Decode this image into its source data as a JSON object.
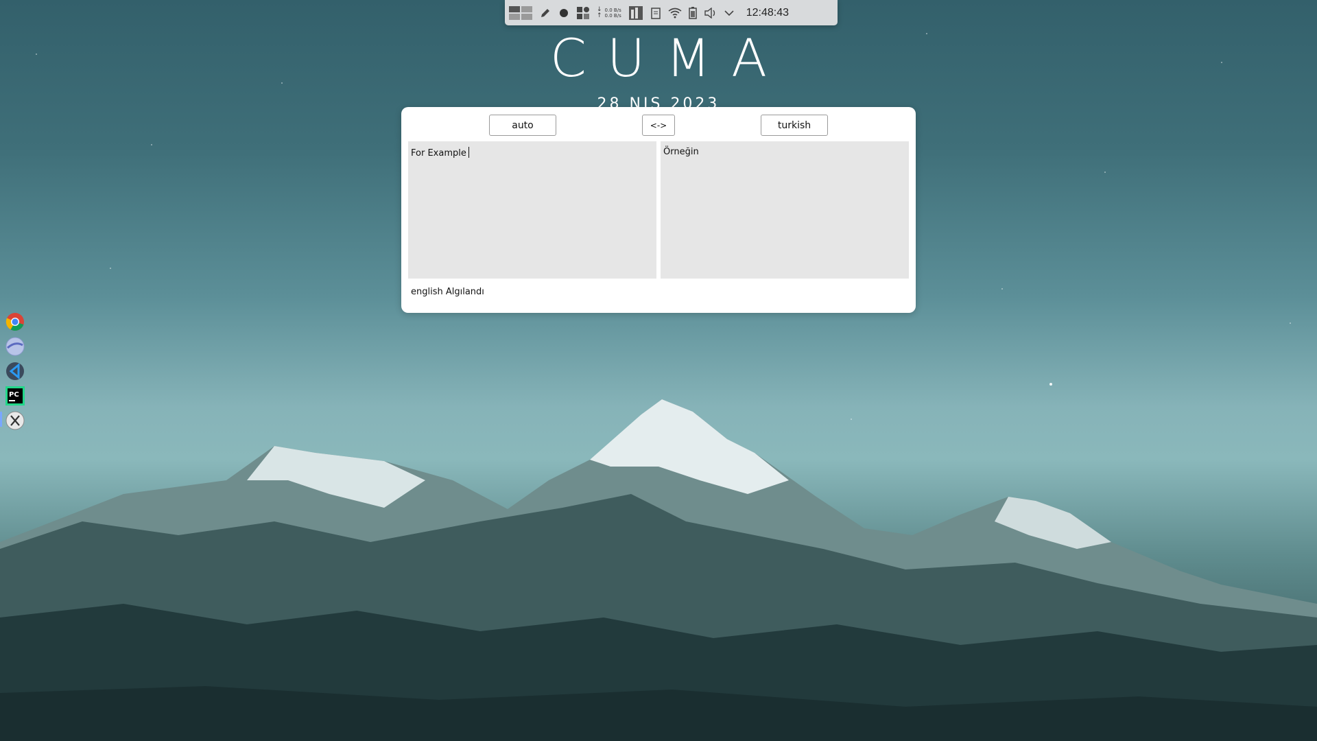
{
  "panel": {
    "clock": "12:48:43",
    "net_down": "0.0 B/s",
    "net_up": "0.0 B/s",
    "icons": [
      "workspace-switcher-icon",
      "pen-icon",
      "record-icon",
      "app-grid-icon",
      "network-speed-icon",
      "system-monitor-icon",
      "clipboard-icon",
      "wifi-icon",
      "battery-icon",
      "volume-icon",
      "chevron-down-icon"
    ]
  },
  "desktop": {
    "title": "CUMA",
    "date": "28 NIS 2023"
  },
  "translator": {
    "source_lang": "auto",
    "swap_label": "<->",
    "target_lang": "turkish",
    "input_text": "For Example",
    "output_text": "Örneğin",
    "status": "english Algılandı"
  },
  "dock": {
    "apps": [
      "chrome-icon",
      "browser-icon",
      "vscode-icon",
      "pycharm-icon",
      "x-app-icon"
    ]
  },
  "colors": {
    "panel_bg": "#d8dadc",
    "window_bg": "#ffffff",
    "textarea_bg": "#e6e6e6",
    "sky_top": "#33606b",
    "sky_mid": "#86b3b8"
  }
}
